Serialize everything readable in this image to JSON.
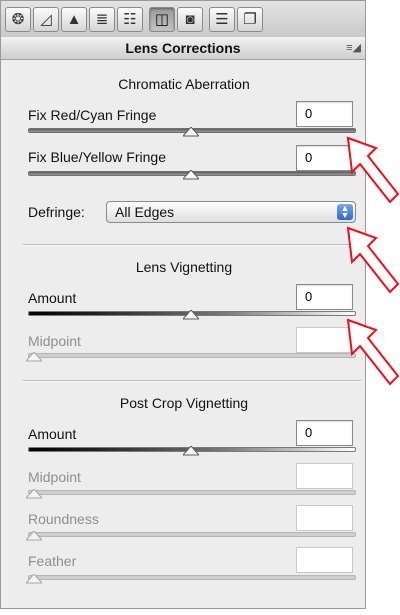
{
  "toolbar": {
    "tabs": [
      {
        "icon": "aperture-icon",
        "glyph": "❂"
      },
      {
        "icon": "curve-grid-icon",
        "glyph": "◿"
      },
      {
        "icon": "detail-mountain-icon",
        "glyph": "▲"
      },
      {
        "icon": "hsl-lines-icon",
        "glyph": "≣"
      },
      {
        "icon": "split-toning-icon",
        "glyph": "☷"
      },
      {
        "icon": "lens-corrections-icon",
        "glyph": "◫"
      },
      {
        "icon": "camera-calibration-icon",
        "glyph": "◙"
      },
      {
        "icon": "presets-icon",
        "glyph": "☰"
      },
      {
        "icon": "snapshots-icon",
        "glyph": "❐"
      }
    ]
  },
  "panel": {
    "title": "Lens Corrections",
    "menu_glyph": "≡◢"
  },
  "chromatic_aberration": {
    "title": "Chromatic Aberration",
    "red_cyan": {
      "label": "Fix Red/Cyan Fringe",
      "value": "0",
      "slider_position": 0.5
    },
    "blue_yellow": {
      "label": "Fix Blue/Yellow Fringe",
      "value": "0",
      "slider_position": 0.5
    },
    "defringe": {
      "label": "Defringe:",
      "selected": "All Edges"
    }
  },
  "lens_vignetting": {
    "title": "Lens Vignetting",
    "amount": {
      "label": "Amount",
      "value": "0",
      "slider_position": 0.5
    },
    "midpoint": {
      "label": "Midpoint",
      "value": "",
      "slider_position": 0.0
    }
  },
  "post_crop_vignetting": {
    "title": "Post Crop Vignetting",
    "amount": {
      "label": "Amount",
      "value": "0",
      "slider_position": 0.5
    },
    "midpoint": {
      "label": "Midpoint",
      "value": "",
      "slider_position": 0.0
    },
    "roundness": {
      "label": "Roundness",
      "value": "",
      "slider_position": 0.0
    },
    "feather": {
      "label": "Feather",
      "value": "",
      "slider_position": 0.0
    }
  },
  "colors": {
    "annotation_arrow": "#e8101a",
    "select_accent": "#2f67c6"
  }
}
